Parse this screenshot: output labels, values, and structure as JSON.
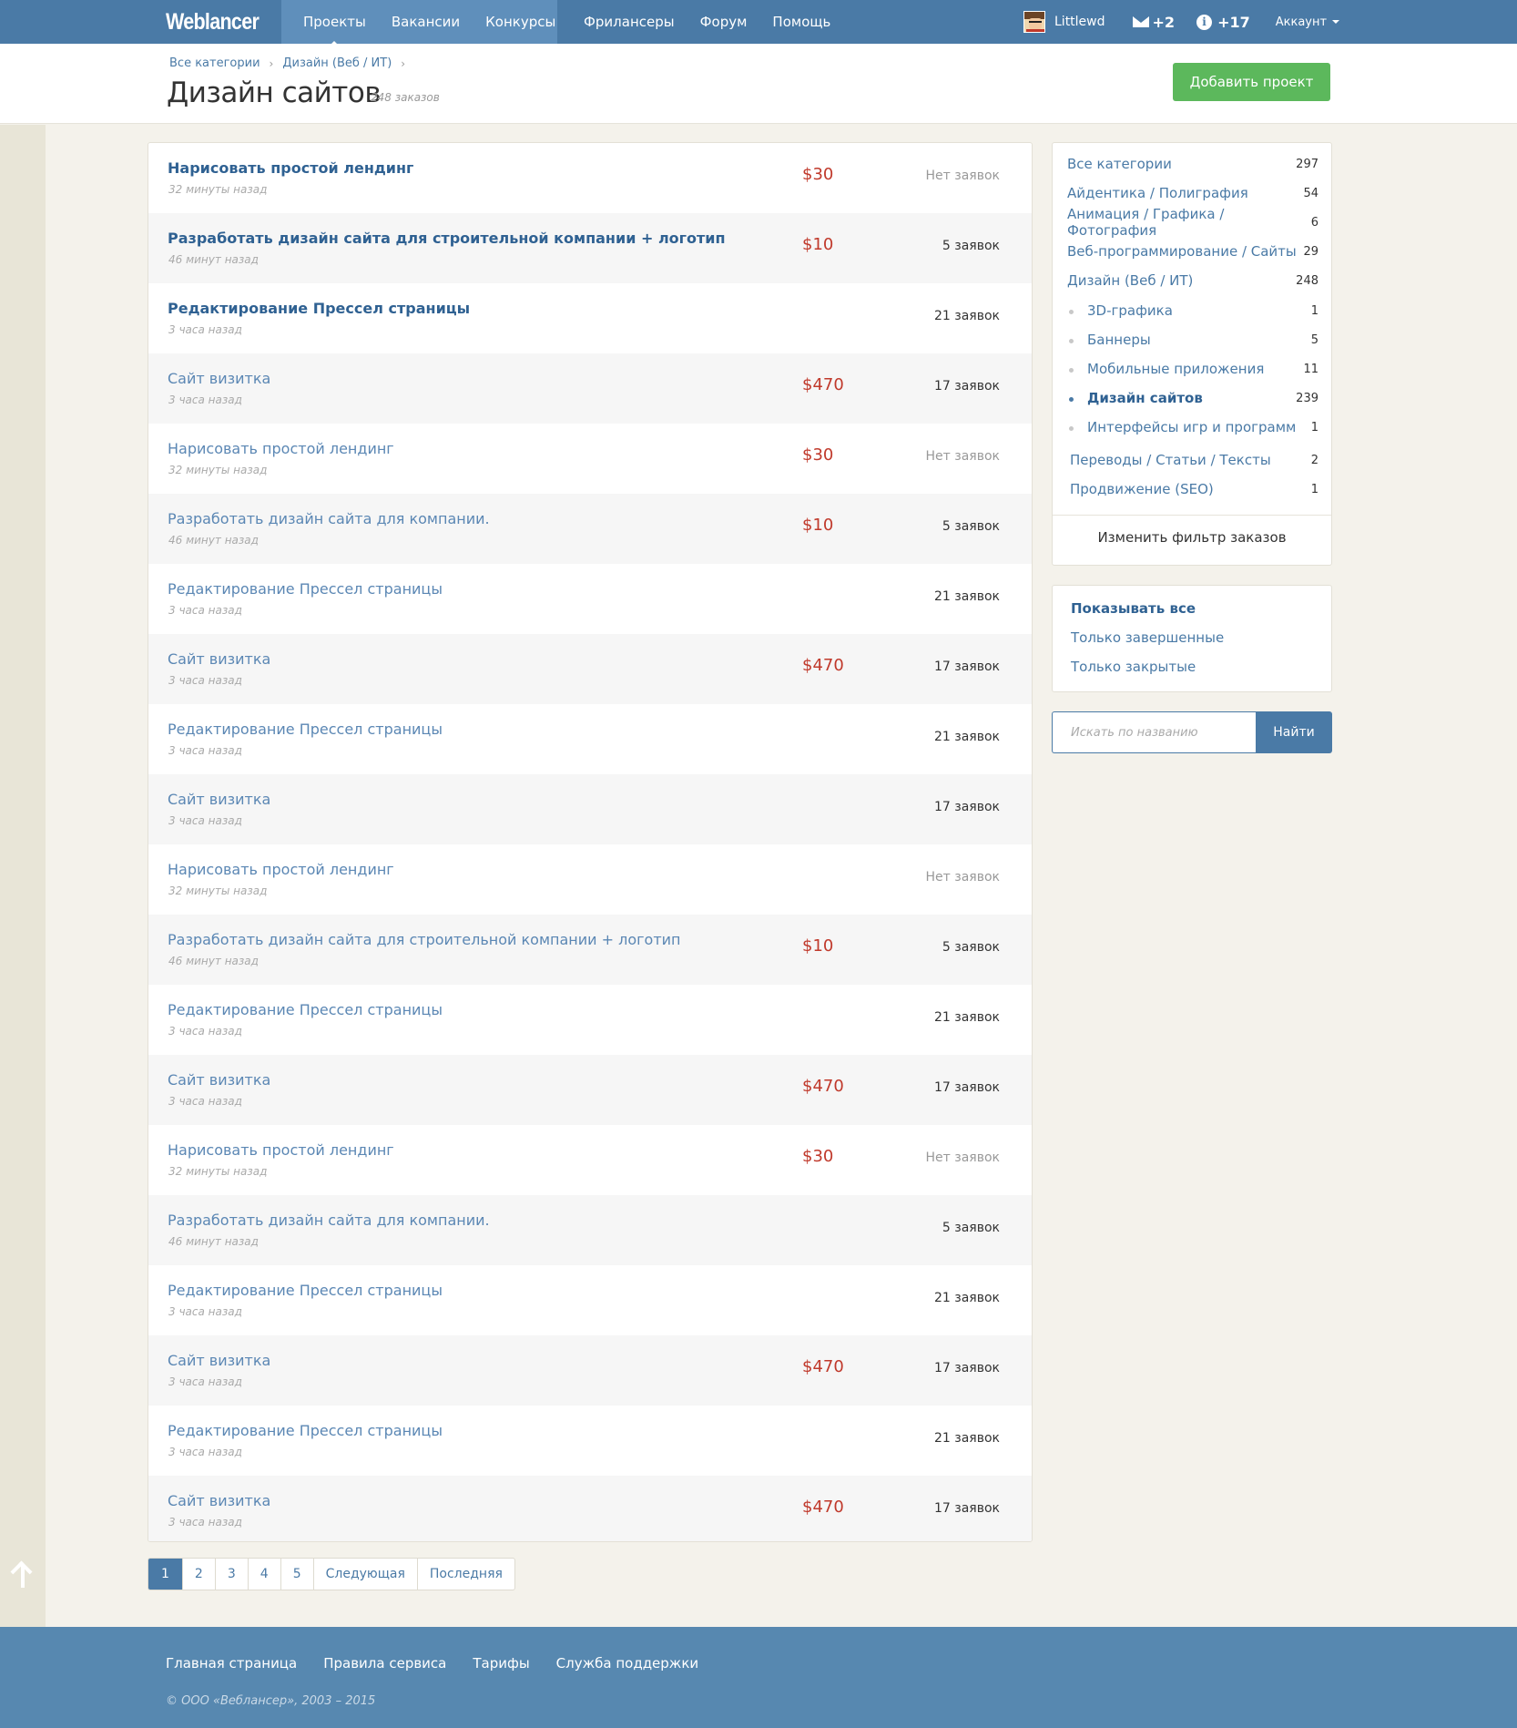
{
  "brand": {
    "logo": "Weblancer"
  },
  "nav": {
    "primary": [
      "Проекты",
      "Вакансии",
      "Конкурсы"
    ],
    "secondary": [
      "Фрилансеры",
      "Форум",
      "Помощь"
    ]
  },
  "user": {
    "name": "Littlewd",
    "messages": "+2",
    "notifications": "+17",
    "account": "Аккаунт"
  },
  "header": {
    "breadcrumb": [
      "Все категории",
      "Дизайн (Веб / ИТ)"
    ],
    "title": "Дизайн сайтов",
    "count": "248 заказов",
    "add_button": "Добавить проект"
  },
  "projects": [
    {
      "title": "Нарисовать простой лендинг",
      "time": "32 минуты назад",
      "price": "$30",
      "bids": "Нет заявок",
      "bold": true
    },
    {
      "title": "Разработать дизайн сайта для строительной компании + логотип",
      "time": "46 минут назад",
      "price": "$10",
      "bids": "5 заявок",
      "bold": true
    },
    {
      "title": "Редактирование Прессел страницы",
      "time": "3 часа назад",
      "price": "",
      "bids": "21 заявок",
      "bold": true
    },
    {
      "title": "Сайт визитка",
      "time": "3 часа назад",
      "price": "$470",
      "bids": "17 заявок",
      "bold": false
    },
    {
      "title": "Нарисовать простой лендинг",
      "time": "32 минуты назад",
      "price": "$30",
      "bids": "Нет заявок",
      "bold": false
    },
    {
      "title": "Разработать дизайн сайта для компании.",
      "time": "46 минут назад",
      "price": "$10",
      "bids": "5 заявок",
      "bold": false
    },
    {
      "title": "Редактирование Прессел страницы",
      "time": "3 часа назад",
      "price": "",
      "bids": "21 заявок",
      "bold": false
    },
    {
      "title": "Сайт визитка",
      "time": "3 часа назад",
      "price": "$470",
      "bids": "17 заявок",
      "bold": false
    },
    {
      "title": "Редактирование Прессел страницы",
      "time": "3 часа назад",
      "price": "",
      "bids": "21 заявок",
      "bold": false
    },
    {
      "title": "Сайт визитка",
      "time": "3 часа назад",
      "price": "",
      "bids": "17 заявок",
      "bold": false
    },
    {
      "title": "Нарисовать простой лендинг",
      "time": "32 минуты назад",
      "price": "",
      "bids": "Нет заявок",
      "bold": false
    },
    {
      "title": "Разработать дизайн сайта для строительной компании + логотип",
      "time": "46 минут назад",
      "price": "$10",
      "bids": "5 заявок",
      "bold": false
    },
    {
      "title": "Редактирование Прессел страницы",
      "time": "3 часа назад",
      "price": "",
      "bids": "21 заявок",
      "bold": false
    },
    {
      "title": "Сайт визитка",
      "time": "3 часа назад",
      "price": "$470",
      "bids": "17 заявок",
      "bold": false
    },
    {
      "title": "Нарисовать простой лендинг",
      "time": "32 минуты назад",
      "price": "$30",
      "bids": "Нет заявок",
      "bold": false
    },
    {
      "title": "Разработать дизайн сайта для компании.",
      "time": "46 минут назад",
      "price": "",
      "bids": "5 заявок",
      "bold": false
    },
    {
      "title": "Редактирование Прессел страницы",
      "time": "3 часа назад",
      "price": "",
      "bids": "21 заявок",
      "bold": false
    },
    {
      "title": "Сайт визитка",
      "time": "3 часа назад",
      "price": "$470",
      "bids": "17 заявок",
      "bold": false
    },
    {
      "title": "Редактирование Прессел страницы",
      "time": "3 часа назад",
      "price": "",
      "bids": "21 заявок",
      "bold": false
    },
    {
      "title": "Сайт визитка",
      "time": "3 часа назад",
      "price": "$470",
      "bids": "17 заявок",
      "bold": false
    }
  ],
  "pagination": [
    "1",
    "2",
    "3",
    "4",
    "5",
    "Следующая",
    "Последняя"
  ],
  "categories": [
    {
      "name": "Все категории",
      "count": "297",
      "level": "top"
    },
    {
      "name": "Айдентика / Полиграфия",
      "count": "54",
      "level": "top"
    },
    {
      "name": "Анимация / Графика / Фотография",
      "count": "6",
      "level": "top"
    },
    {
      "name": "Веб-программирование / Сайты",
      "count": "29",
      "level": "top"
    },
    {
      "name": "Дизайн (Веб / ИТ)",
      "count": "248",
      "level": "top"
    },
    {
      "name": "3D-графика",
      "count": "1",
      "level": "sub"
    },
    {
      "name": "Баннеры",
      "count": "5",
      "level": "sub"
    },
    {
      "name": "Мобильные приложения",
      "count": "11",
      "level": "sub"
    },
    {
      "name": "Дизайн сайтов",
      "count": "239",
      "level": "sub",
      "current": true
    },
    {
      "name": "Интерфейсы игр и программ",
      "count": "1",
      "level": "sub"
    },
    {
      "name": "Переводы / Статьи / Тексты",
      "count": "2",
      "level": "lower"
    },
    {
      "name": "Продвижение (SEO)",
      "count": "1",
      "level": "lower"
    }
  ],
  "filter_link": "Изменить фильтр заказов",
  "status_filters": [
    "Показывать все",
    "Только завершенные",
    "Только закрытые"
  ],
  "search": {
    "placeholder": "Искать по названию",
    "button": "Найти"
  },
  "footer": {
    "links": [
      "Главная страница",
      "Правила сервиса",
      "Тарифы",
      "Служба поддержки"
    ],
    "copyright": "© ООО «Веблансер», 2003 – 2015"
  }
}
